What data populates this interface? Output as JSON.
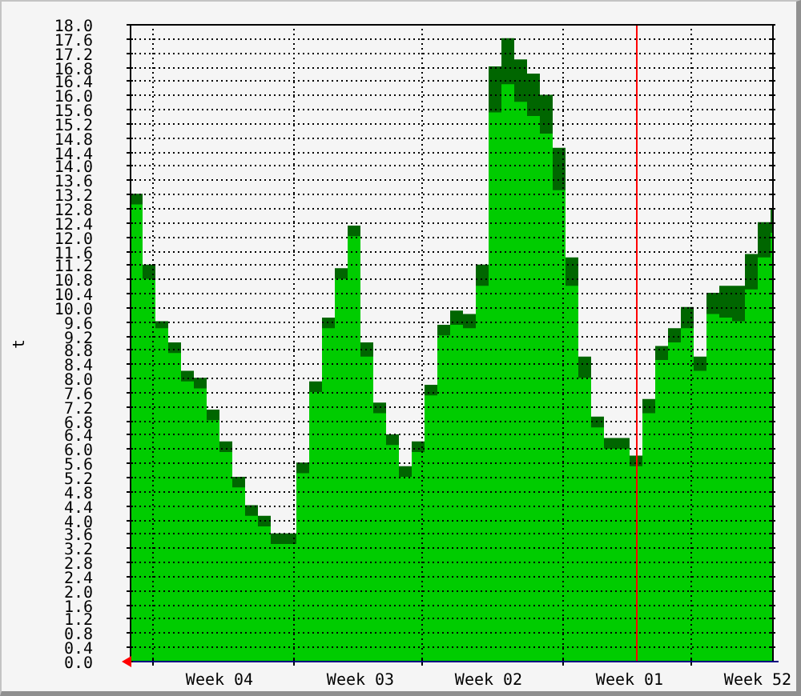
{
  "graph": {
    "chart_data": {
      "type": "area",
      "ylabel": "t",
      "categories": [
        null,
        null,
        null,
        null,
        null,
        null,
        null,
        "Week 04",
        null,
        null,
        null,
        null,
        null,
        null,
        null,
        null,
        null,
        null,
        "Week 03",
        null,
        null,
        null,
        null,
        null,
        null,
        null,
        null,
        null,
        "Week 02",
        null,
        null,
        null,
        null,
        null,
        null,
        null,
        null,
        null,
        null,
        "Week 01",
        null,
        null,
        null,
        null,
        null,
        null,
        null,
        null,
        null,
        "Week 52",
        null
      ],
      "series": [
        {
          "color": "#006600",
          "values": [
            13.2,
            11.2,
            9.6,
            9.0,
            8.2,
            8.0,
            7.1,
            6.2,
            5.2,
            4.4,
            4.1,
            3.6,
            3.6,
            5.6,
            7.9,
            9.7,
            11.1,
            12.3,
            9.0,
            7.3,
            6.4,
            5.5,
            6.2,
            7.8,
            9.5,
            9.9,
            9.8,
            11.2,
            16.8,
            17.6,
            17.0,
            16.6,
            16.0,
            14.5,
            11.4,
            8.6,
            6.9,
            6.3,
            6.3,
            5.8,
            7.4,
            8.9,
            9.4,
            10.0,
            8.6,
            10.4,
            10.6,
            10.6,
            11.5,
            12.4,
            12.8
          ]
        },
        {
          "color": "#00cc00",
          "values": [
            12.9,
            10.8,
            9.4,
            8.7,
            7.9,
            7.7,
            6.8,
            5.9,
            4.9,
            4.1,
            3.8,
            3.3,
            3.3,
            5.3,
            7.6,
            9.4,
            10.8,
            12.0,
            8.6,
            7.0,
            6.1,
            5.2,
            5.9,
            7.5,
            9.2,
            9.5,
            9.4,
            10.6,
            15.5,
            16.3,
            15.8,
            15.4,
            14.9,
            13.3,
            10.6,
            8.0,
            6.6,
            6.0,
            6.0,
            5.5,
            7.0,
            8.5,
            9.0,
            9.4,
            8.2,
            9.8,
            9.7,
            9.6,
            10.5,
            11.4,
            12.1
          ]
        }
      ],
      "ylim": [
        0,
        18
      ],
      "yticks": [
        {
          "value": 0,
          "label": "0.0"
        },
        {
          "value": 0.4,
          "label": "0.4"
        },
        {
          "value": 0.8,
          "label": "0.8"
        },
        {
          "value": 1.2,
          "label": "1.2"
        },
        {
          "value": 1.6,
          "label": "1.6"
        },
        {
          "value": 2,
          "label": "2.0"
        },
        {
          "value": 2.4,
          "label": "2.4"
        },
        {
          "value": 2.8,
          "label": "2.8"
        },
        {
          "value": 3.2,
          "label": "3.2"
        },
        {
          "value": 3.6,
          "label": "3.6"
        },
        {
          "value": 4,
          "label": "4.0"
        },
        {
          "value": 4.4,
          "label": "4.4"
        },
        {
          "value": 4.8,
          "label": "4.8"
        },
        {
          "value": 5.2,
          "label": "5.2"
        },
        {
          "value": 5.6,
          "label": "5.6"
        },
        {
          "value": 6,
          "label": "6.0"
        },
        {
          "value": 6.4,
          "label": "6.4"
        },
        {
          "value": 6.8,
          "label": "6.8"
        },
        {
          "value": 7.2,
          "label": "7.2"
        },
        {
          "value": 7.6,
          "label": "7.6"
        },
        {
          "value": 8,
          "label": "8.0"
        },
        {
          "value": 8.4,
          "label": "8.4"
        },
        {
          "value": 8.8,
          "label": "8.8"
        },
        {
          "value": 9.2,
          "label": "9.2"
        },
        {
          "value": 9.6,
          "label": "9.6"
        },
        {
          "value": 10,
          "label": "10.0"
        },
        {
          "value": 10.4,
          "label": "10.4"
        },
        {
          "value": 10.8,
          "label": "10.8"
        },
        {
          "value": 11.2,
          "label": "11.2"
        },
        {
          "value": 11.6,
          "label": "11.6"
        },
        {
          "value": 12,
          "label": "12.0"
        },
        {
          "value": 12.4,
          "label": "12.4"
        },
        {
          "value": 12.8,
          "label": "12.8"
        },
        {
          "value": 13.2,
          "label": "13.2"
        },
        {
          "value": 13.6,
          "label": "13.6"
        },
        {
          "value": 14,
          "label": "14.0"
        },
        {
          "value": 14.4,
          "label": "14.4"
        },
        {
          "value": 14.8,
          "label": "14.8"
        },
        {
          "value": 15.2,
          "label": "15.2"
        },
        {
          "value": 15.6,
          "label": "15.6"
        },
        {
          "value": 16,
          "label": "16.0"
        },
        {
          "value": 16.4,
          "label": "16.4"
        },
        {
          "value": 16.8,
          "label": "16.8"
        },
        {
          "value": 17.2,
          "label": "17.2"
        },
        {
          "value": 17.6,
          "label": "17.6"
        },
        {
          "value": 18,
          "label": "18.0"
        }
      ],
      "grid": true
    }
  }
}
